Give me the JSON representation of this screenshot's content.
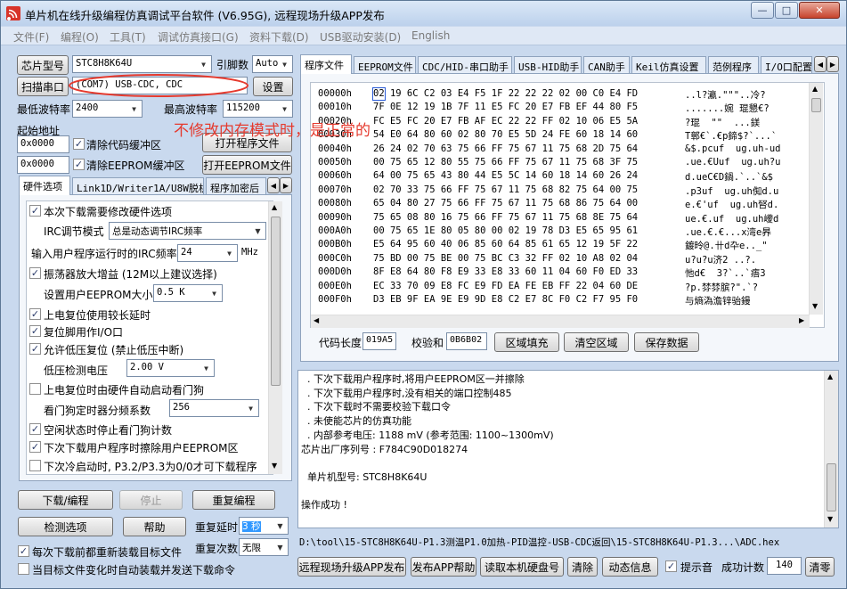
{
  "window": {
    "title": "单片机在线升级编程仿真调试平台软件 (V6.95G), 远程现场升级APP发布",
    "min": "—",
    "max": "□",
    "close": "✕"
  },
  "menu": [
    "文件(F)",
    "编程(O)",
    "工具(T)",
    "调试仿真接口(G)",
    "资料下载(D)",
    "USB驱动安装(D)",
    "English"
  ],
  "left": {
    "chip_btn": "芯片型号",
    "chip_value": "STC8H8K64U",
    "pins_label": "引脚数",
    "pins_value": "Auto",
    "scan_btn": "扫描串口",
    "port_value": "(COM7) USB-CDC, CDC",
    "settings_btn": "设置",
    "min_baud_label": "最低波特率",
    "min_baud_value": "2400",
    "max_baud_label": "最高波特率",
    "max_baud_value": "115200",
    "start_addr_label": "起始地址",
    "code_addr": "0x0000",
    "clear_code_label": "清除代码缓冲区",
    "open_prog_btn": "打开程序文件",
    "eeprom_addr": "0x0000",
    "clear_eeprom_label": "清除EEPROM缓冲区",
    "open_eeprom_btn": "打开EEPROM文件",
    "tabs": [
      "硬件选项",
      "Link1D/Writer1A/U8W脱机",
      "程序加密后"
    ],
    "options": {
      "modify_hw": "本次下载需要修改硬件选项",
      "irc_mode_label": "IRC调节模式",
      "irc_mode_value": "总是动态调节IRC频率",
      "irc_freq_label": "输入用户程序运行时的IRC频率",
      "irc_freq_value": "24",
      "irc_freq_unit": "MHz",
      "amp_gain": "振荡器放大增益 (12M以上建议选择)",
      "eeprom_size_label": "设置用户EEPROM大小",
      "eeprom_size_value": "0.5 K",
      "long_delay": "上电复位使用较长延时",
      "reset_pin": "复位脚用作I/O口",
      "lvd_reset": "允许低压复位 (禁止低压中断)",
      "lvd_label": "低压检测电压",
      "lvd_value": "2.00 V",
      "wdt_auto": "上电复位时由硬件自动启动看门狗",
      "wdt_div_label": "看门狗定时器分频系数",
      "wdt_div_value": "256",
      "idle_wdt": "空闲状态时停止看门狗计数",
      "erase_eeprom": "下次下载用户程序时擦除用户EEPROM区",
      "cold_boot": "下次冷启动时, P3.2/P3.3为0/0才可下载程序"
    },
    "download_btn": "下载/编程",
    "stop_btn": "停止",
    "reprogram_btn": "重复编程",
    "check_btn": "检测选项",
    "help_btn": "帮助",
    "repeat_delay_label": "重复延时",
    "repeat_delay_value": "3 秒",
    "repeat_count_label": "重复次数",
    "repeat_count_value": "无限",
    "reload_label": "每次下载前都重新装载目标文件",
    "auto_send_label": "当目标文件变化时自动装载并发送下载命令"
  },
  "right": {
    "tabs": [
      "程序文件",
      "EEPROM文件",
      "CDC/HID-串口助手",
      "USB-HID助手",
      "CAN助手",
      "Keil仿真设置",
      "范例程序",
      "I/O口配置"
    ],
    "hex": [
      {
        "addr": "00000h",
        "bytes": "02 19 6C C2 03 E4 F5 1F 22 22 22 02 00 C0 E4 FD",
        "ascii": "..l?瀛.\"\"\"..冷?"
      },
      {
        "addr": "00010h",
        "bytes": "7F 0E 12 19 1B 7F 11 E5 FC 20 E7 FB EF 44 80 F5",
        "ascii": ".......婉 琨懇€?"
      },
      {
        "addr": "00020h",
        "bytes": "FC E5 FC 20 E7 FB AF EC 22 22 FF 02 10 06 E5 5A",
        "ascii": "?琨  \"\"  ...鎂"
      },
      {
        "addr": "00030h",
        "bytes": "54 E0 64 80 60 02 80 70 E5 5D 24 FE 60 18 14 60",
        "ascii": "T鄣€`.€p鍗$?`...`"
      },
      {
        "addr": "00040h",
        "bytes": "26 24 02 70 63 75 66 FF 75 67 11 75 68 2D 75 64",
        "ascii": "&$.pcuf  ug.uh-ud"
      },
      {
        "addr": "00050h",
        "bytes": "00 75 65 12 80 55 75 66 FF 75 67 11 75 68 3F 75",
        "ascii": ".ue.€Uuf  ug.uh?u"
      },
      {
        "addr": "00060h",
        "bytes": "64 00 75 65 43 80 44 E5 5C 14 60 18 14 60 26 24",
        "ascii": "d.ueC€D鍋.`..`&$"
      },
      {
        "addr": "00070h",
        "bytes": "02 70 33 75 66 FF 75 67 11 75 68 82 75 64 00 75",
        "ascii": ".p3uf  ug.uh倁d.u"
      },
      {
        "addr": "00080h",
        "bytes": "65 04 80 27 75 66 FF 75 67 11 75 68 86 75 64 00",
        "ascii": "e.€'uf  ug.uh唘d."
      },
      {
        "addr": "00090h",
        "bytes": "75 65 08 80 16 75 66 FF 75 67 11 75 68 8E 75 64",
        "ascii": "ue.€.uf  ug.uh巙d"
      },
      {
        "addr": "000A0h",
        "bytes": "00 75 65 1E 80 05 80 00 02 19 78 D3 E5 65 95 61",
        "ascii": ".ue.€.€...x湾e昦"
      },
      {
        "addr": "000B0h",
        "bytes": "E5 64 95 60 40 06 85 60 64 85 61 65 12 19 5F 22",
        "ascii": "鍍昤@.卄d卆e.._\""
      },
      {
        "addr": "000C0h",
        "bytes": "75 BD 00 75 BE 00 75 BC C3 32 FF 02 10 A8 02 04",
        "ascii": "u?u?u济2 ..?."
      },
      {
        "addr": "000D0h",
        "bytes": "8F E8 64 80 F8 E9 33 E8 33 60 11 04 60 F0 ED 33",
        "ascii": "忚d€  3?`..`痦3"
      },
      {
        "addr": "000E0h",
        "bytes": "EC 33 70 09 E8 FC E9 FD EA FE EB FF 22 04 60 DE",
        "ascii": "?p.棼棼膑?\".`?"
      },
      {
        "addr": "000F0h",
        "bytes": "D3 EB 9F EA 9E E9 9D E8 C2 E7 8C F0 C2 F7 95 F0",
        "ascii": "与熵溈澹锌骀鏝"
      }
    ],
    "annotation": "不修改内存模式时，是正常的",
    "code_len_label": "代码长度",
    "code_len_value": "019A5",
    "checksum_label": "校验和",
    "checksum_value": "0B6B02",
    "fill_btn": "区域填充",
    "clear_area_btn": "清空区域",
    "save_btn": "保存数据",
    "log": [
      "  . 下次下载用户程序时,将用户EEPROM区一并擦除",
      "  . 下次下载用户程序时,没有相关的端口控制485",
      "  . 下次下载时不需要校验下载口令",
      "  . 未使能芯片的仿真功能",
      "  . 内部参考电压: 1188 mV (参考范围: 1100~1300mV)",
      "芯片出厂序列号 : F784C90D018274",
      "",
      "  单片机型号: STC8H8K64U",
      "",
      "操作成功 !"
    ],
    "path": "D:\\tool\\15-STC8H8K64U-P1.3测温P1.0加热-PID温控-USB-CDC返回\\15-STC8H8K64U-P1.3...\\ADC.hex",
    "remote_btn": "远程现场升级APP发布",
    "publish_help_btn": "发布APP帮助",
    "read_disk_btn": "读取本机硬盘号",
    "clear_btn": "清除",
    "anim_btn": "动态信息",
    "beep_label": "提示音",
    "success_label": "成功计数",
    "success_value": "140",
    "reset_count_btn": "清零"
  },
  "colors": {
    "annotation": "#e53a2e",
    "highlight": "#3399ff"
  }
}
